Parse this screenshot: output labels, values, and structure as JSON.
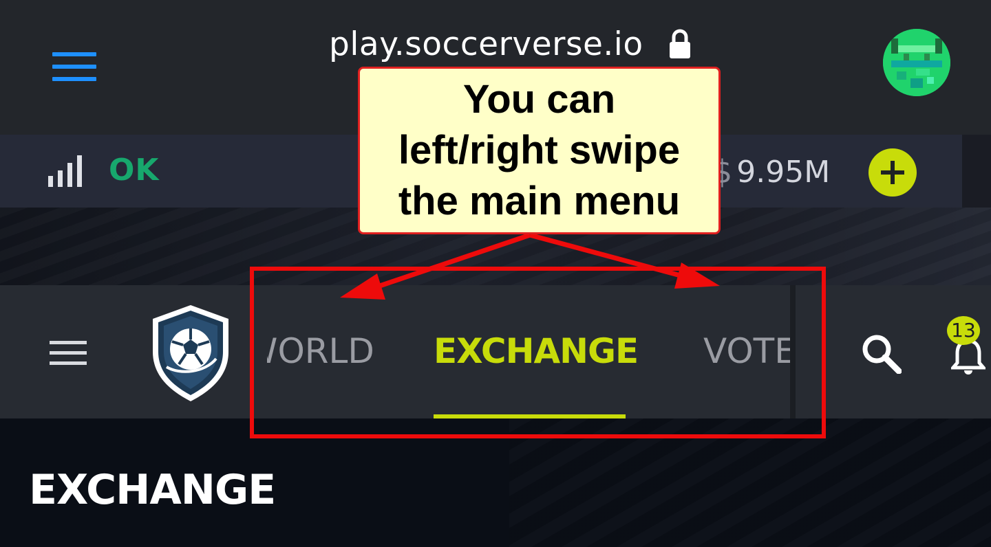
{
  "browser": {
    "url": "play.soccerverse.io",
    "menu_icon": "hamburger-icon",
    "lock_icon": "lock-icon",
    "avatar_icon": "pixel-avatar-icon",
    "accent_color": "#1e90ff"
  },
  "status_bar": {
    "signal_icon": "signal-bars-icon",
    "connection_status": "OK",
    "currency_symbol": "$",
    "balance": "9.95M",
    "add_icon": "plus-icon",
    "status_color": "#17a86d"
  },
  "nav": {
    "menu_icon": "hamburger-icon",
    "logo_icon": "soccerverse-shield-logo",
    "tabs": [
      {
        "label": "WORLD",
        "visible_label": "ORLD",
        "active": false
      },
      {
        "label": "EXCHANGE",
        "active": true
      },
      {
        "label": "VOTE",
        "active": false
      }
    ],
    "search_icon": "search-icon",
    "bell_icon": "bell-icon",
    "notification_count": "13",
    "accent_color": "#c8dc0a"
  },
  "page": {
    "title": "EXCHANGE"
  },
  "annotation": {
    "callout_text": "You can\nleft/right swipe\nthe main menu",
    "highlight_color": "#ee0b0b",
    "callout_bg": "#ffffc8"
  }
}
